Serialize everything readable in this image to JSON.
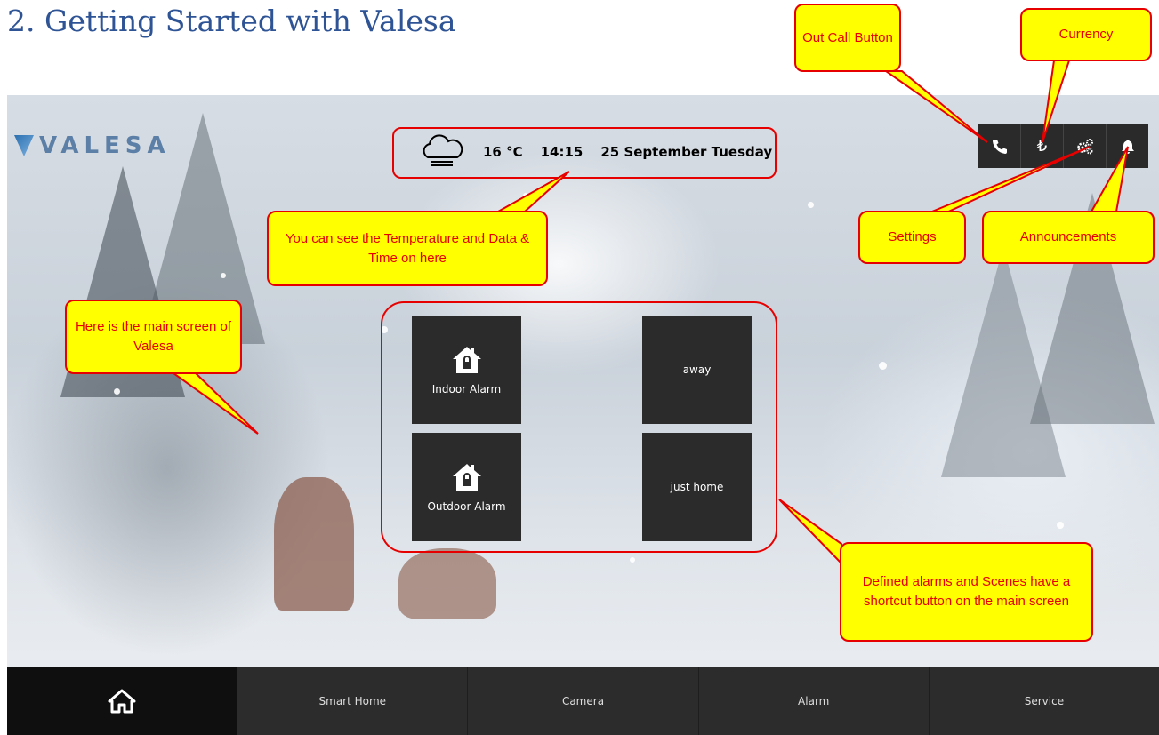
{
  "doc_title": "2. Getting Started with Valesa",
  "app": {
    "logo_text": "VALESA",
    "weather": {
      "icon": "cloud-rain-icon",
      "temperature": "16 °C",
      "time": "14:15",
      "date": "25 September Tuesday"
    },
    "top_icons": [
      {
        "name": "phone-icon"
      },
      {
        "name": "lira-currency-icon",
        "glyph": "₺"
      },
      {
        "name": "gears-icon"
      },
      {
        "name": "bell-icon"
      }
    ],
    "tiles": [
      {
        "label": "Indoor Alarm",
        "icon": "house-lock-icon"
      },
      {
        "label": "away"
      },
      {
        "label": "Outdoor Alarm",
        "icon": "house-lock-icon"
      },
      {
        "label": "just home"
      }
    ],
    "bottom_nav": [
      {
        "label": "",
        "icon": "home-icon"
      },
      {
        "label": "Smart Home"
      },
      {
        "label": "Camera"
      },
      {
        "label": "Alarm"
      },
      {
        "label": "Service"
      }
    ]
  },
  "callouts": {
    "out_call": "Out Call Button",
    "currency": "Currency",
    "settings": "Settings",
    "announcements": "Announcements",
    "temperature": "You can see the Temperature and Data & Time on here",
    "main_screen": "Here is the main screen of Valesa",
    "shortcuts": "Defined alarms and Scenes have a shortcut button on the main screen"
  },
  "colors": {
    "title": "#2f5496",
    "callout_fill": "#ffff00",
    "callout_border": "#e60000",
    "tile": "#2b2b2b"
  }
}
